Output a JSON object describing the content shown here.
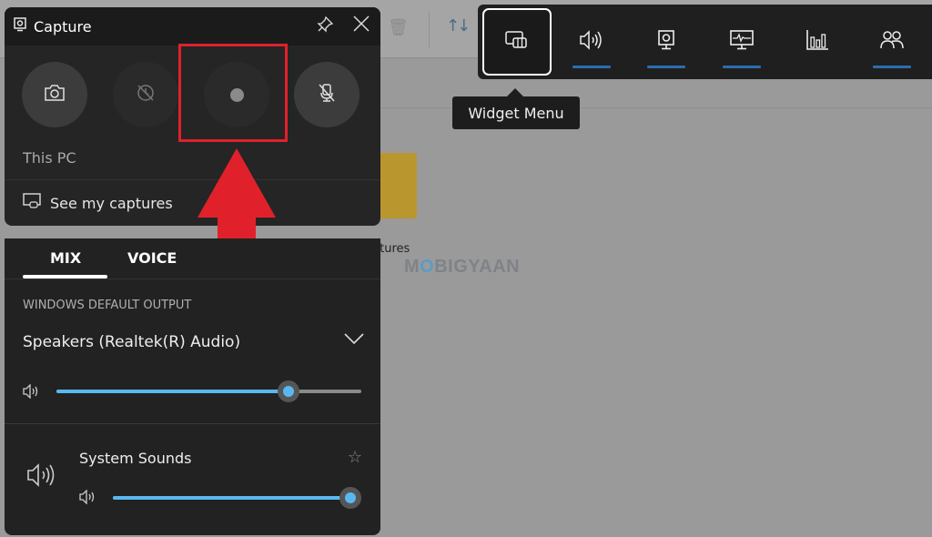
{
  "background": {
    "folder_label": "ctures",
    "watermark": {
      "pre": "M",
      "o": "O",
      "post": "BIGYAAN"
    }
  },
  "capture": {
    "title": "Capture",
    "buttons": [
      {
        "name": "screenshot",
        "icon": "camera-icon",
        "state": "enabled"
      },
      {
        "name": "record-last-30s",
        "icon": "record-last-icon",
        "state": "disabled"
      },
      {
        "name": "start-recording",
        "icon": "record-dot-icon",
        "state": "disabled",
        "highlighted": true
      },
      {
        "name": "mic-toggle",
        "icon": "mic-off-icon",
        "state": "enabled"
      }
    ],
    "source": "This PC",
    "see_captures": "See my captures"
  },
  "audio": {
    "tabs": [
      {
        "label": "MIX",
        "active": true
      },
      {
        "label": "VOICE",
        "active": false
      }
    ],
    "section_label": "WINDOWS DEFAULT OUTPUT",
    "device": "Speakers (Realtek(R) Audio)",
    "master_volume_pct": 76,
    "apps": [
      {
        "name": "System Sounds",
        "volume_pct": 100,
        "favorite": false
      }
    ]
  },
  "gamebar": {
    "items": [
      {
        "name": "widget-menu",
        "active": true,
        "underline": false
      },
      {
        "name": "audio",
        "active": false,
        "underline": true
      },
      {
        "name": "capture",
        "active": false,
        "underline": true
      },
      {
        "name": "performance",
        "active": false,
        "underline": true
      },
      {
        "name": "resources",
        "active": false,
        "underline": false
      },
      {
        "name": "xbox-social",
        "active": false,
        "underline": true
      }
    ],
    "tooltip": "Widget Menu"
  },
  "annotation_color": "#e0212b",
  "accent_color": "#5ab8f0"
}
